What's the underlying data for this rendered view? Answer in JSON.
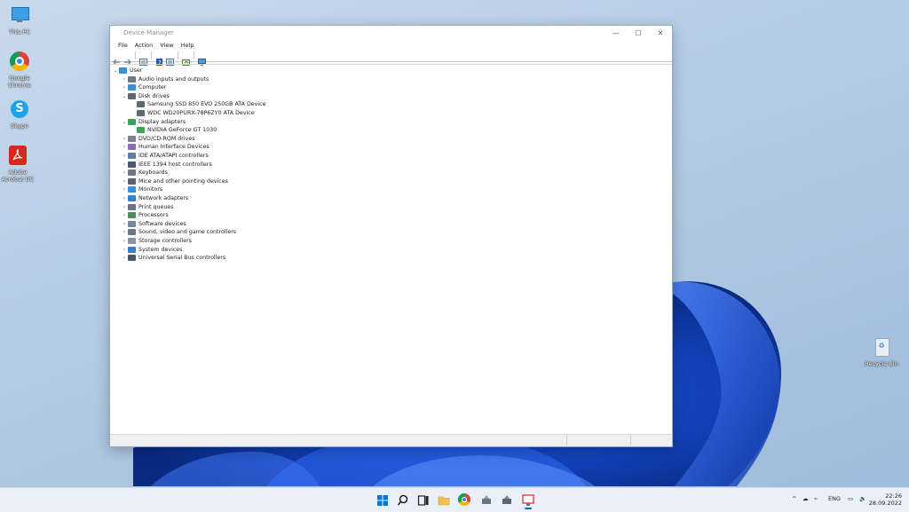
{
  "desktop": {
    "icons": [
      {
        "label_line1": "This PC",
        "label_line2": ""
      },
      {
        "label_line1": "Google",
        "label_line2": "Chrome"
      },
      {
        "label_line1": "Skype",
        "label_line2": ""
      },
      {
        "label_line1": "Adobe",
        "label_line2": "Acrobat DC"
      },
      {
        "label_line1": "Recycle Bin",
        "label_line2": ""
      }
    ]
  },
  "window": {
    "title": "Device Manager",
    "controls": {
      "minimize": "—",
      "maximize": "☐",
      "close": "✕"
    },
    "menu": [
      "File",
      "Action",
      "View",
      "Help"
    ],
    "toolbar_icons": [
      "back-icon",
      "forward-icon",
      "properties-icon",
      "help-icon",
      "view-icon",
      "update-driver-icon",
      "monitor-icon"
    ],
    "tree": {
      "root": "User",
      "items": [
        {
          "label": "Audio inputs and outputs",
          "expanded": false,
          "icon": "speaker-icon"
        },
        {
          "label": "Computer",
          "expanded": false,
          "icon": "computer-icon"
        },
        {
          "label": "Disk drives",
          "expanded": true,
          "icon": "disk-icon",
          "children": [
            "Samsung SSD 850 EVO 250GB ATA Device",
            "WDC WD20PURX-78P6ZY0 ATA Device"
          ]
        },
        {
          "label": "Display adapters",
          "expanded": true,
          "icon": "display-adapter-icon",
          "children": [
            "NVIDIA GeForce GT 1030"
          ]
        },
        {
          "label": "DVD/CD-ROM drives",
          "expanded": false,
          "icon": "dvd-icon"
        },
        {
          "label": "Human Interface Devices",
          "expanded": false,
          "icon": "hid-icon"
        },
        {
          "label": "IDE ATA/ATAPI controllers",
          "expanded": false,
          "icon": "ide-icon"
        },
        {
          "label": "IEEE 1394 host controllers",
          "expanded": false,
          "icon": "ieee-icon"
        },
        {
          "label": "Keyboards",
          "expanded": false,
          "icon": "keyboard-icon"
        },
        {
          "label": "Mice and other pointing devices",
          "expanded": false,
          "icon": "mouse-icon"
        },
        {
          "label": "Monitors",
          "expanded": false,
          "icon": "monitor-icon"
        },
        {
          "label": "Network adapters",
          "expanded": false,
          "icon": "network-icon"
        },
        {
          "label": "Print queues",
          "expanded": false,
          "icon": "printer-icon"
        },
        {
          "label": "Processors",
          "expanded": false,
          "icon": "processor-icon"
        },
        {
          "label": "Software devices",
          "expanded": false,
          "icon": "software-icon"
        },
        {
          "label": "Sound, video and game controllers",
          "expanded": false,
          "icon": "sound-icon"
        },
        {
          "label": "Storage controllers",
          "expanded": false,
          "icon": "storage-icon"
        },
        {
          "label": "System devices",
          "expanded": false,
          "icon": "system-icon"
        },
        {
          "label": "Universal Serial Bus controllers",
          "expanded": false,
          "icon": "usb-icon"
        }
      ]
    }
  },
  "taskbar": {
    "apps": [
      "start-icon",
      "search-icon",
      "task-view-icon",
      "file-explorer-icon",
      "chrome-icon",
      "app-icon-1",
      "app-icon-2",
      "device-manager-icon"
    ],
    "tray": {
      "chevron": "^",
      "language": "ENG"
    },
    "clock": {
      "time": "22:26",
      "date": "28.09.2022"
    }
  },
  "colors": {
    "accent": "#0067c0",
    "folder": "#f2c14e"
  }
}
